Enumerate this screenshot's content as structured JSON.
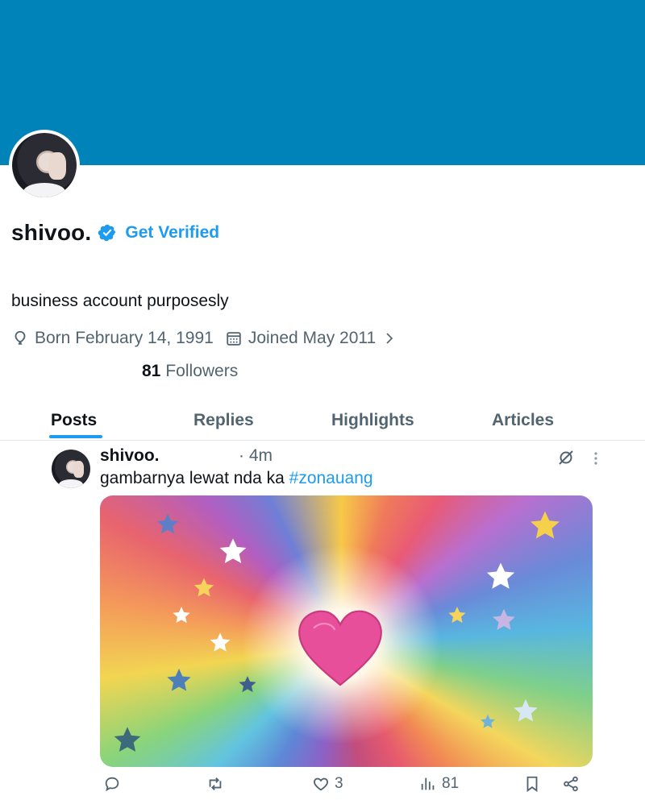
{
  "profile": {
    "display_name": "shivoo.",
    "get_verified_label": "Get Verified",
    "bio": "business account purposesly",
    "born": "Born February 14, 1991",
    "joined": "Joined May 2011",
    "followers_count": "81",
    "followers_label": "Followers"
  },
  "tabs": [
    "Posts",
    "Replies",
    "Highlights",
    "Articles"
  ],
  "active_tab": "Posts",
  "post": {
    "author": "shivoo.",
    "time": "· 4m",
    "text": "gambarnya lewat nda ka ",
    "hashtag": "#zonauang",
    "likes": "3",
    "views": "81"
  },
  "colors": {
    "banner": "#0083b8",
    "accent": "#1d9bf0",
    "secondary_text": "#536471"
  },
  "icons": [
    "verified-badge-icon",
    "birthday-balloon-icon",
    "calendar-icon",
    "chevron-right-icon",
    "grok-icon",
    "more-icon",
    "reply-icon",
    "repost-icon",
    "like-icon",
    "views-icon",
    "bookmark-icon",
    "share-icon"
  ]
}
